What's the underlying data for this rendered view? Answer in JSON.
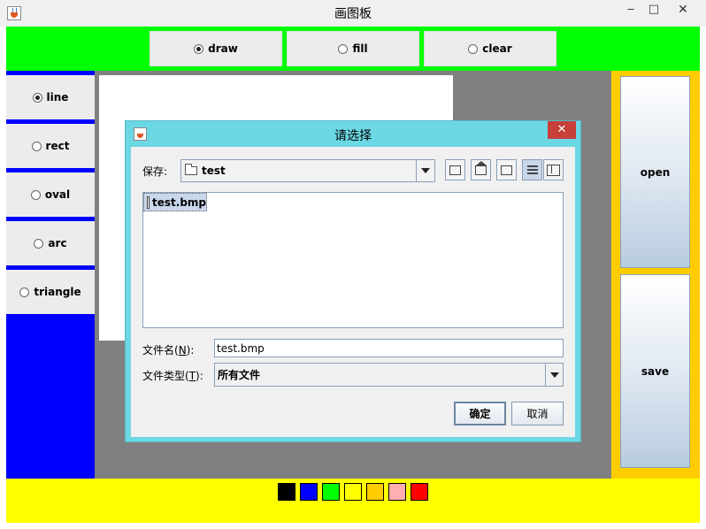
{
  "window": {
    "title": "画图板",
    "minimize": "▭",
    "maximize": "□",
    "close": "✕"
  },
  "modes": [
    {
      "label": "draw",
      "selected": true
    },
    {
      "label": "fill",
      "selected": false
    },
    {
      "label": "clear",
      "selected": false
    }
  ],
  "shapes": [
    {
      "label": "line",
      "selected": true
    },
    {
      "label": "rect",
      "selected": false
    },
    {
      "label": "oval",
      "selected": false
    },
    {
      "label": "arc",
      "selected": false
    },
    {
      "label": "triangle",
      "selected": false
    }
  ],
  "side_buttons": {
    "open": "open",
    "save": "save"
  },
  "colors": [
    "#000000",
    "#0000ff",
    "#00ff00",
    "#ffff00",
    "#ffcc00",
    "#ffafaf",
    "#ff0000"
  ],
  "panel_colors": {
    "top": "#00ff00",
    "left": "#0000ff",
    "right": "#ffcc00",
    "bottom": "#ffff00",
    "canvas_bg": "#808080"
  },
  "dialog": {
    "title": "请选择",
    "close": "✕",
    "save_in_label": "保存:",
    "save_in_value": "test",
    "files": [
      {
        "name": "test.bmp",
        "selected": true
      }
    ],
    "filename_label_pre": "文件名(",
    "filename_label_key": "N",
    "filename_label_post": "):",
    "filename_value": "test.bmp",
    "filetype_label_pre": "文件类型(",
    "filetype_label_key": "T",
    "filetype_label_post": "):",
    "filetype_value": "所有文件",
    "ok_label": "确定",
    "cancel_label": "取消"
  }
}
